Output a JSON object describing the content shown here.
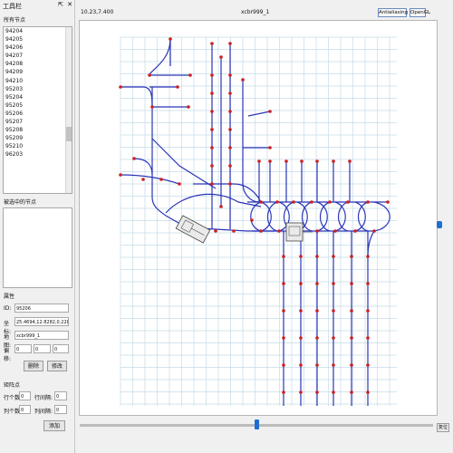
{
  "panel": {
    "title": "工具栏",
    "pin_glyph": "⇱",
    "close_glyph": "✕",
    "all_nodes_label": "所有节点",
    "nodes": [
      "94204",
      "94205",
      "94206",
      "94207",
      "94208",
      "94209",
      "94210",
      "95203",
      "95204",
      "95205",
      "95206",
      "95207",
      "95208",
      "95209",
      "95210",
      "96203"
    ],
    "selected_nodes_label": "被选中的节点",
    "attr_label": "属性",
    "id_label": "ID:",
    "id_value": "95206",
    "coord_label": "坐标:",
    "coord_value": "25.4694,12.8282,0.228",
    "map_label": "地图:",
    "map_value": "xcbr999_1",
    "param_label": "偏移:",
    "param_values": [
      "0",
      "0",
      "0"
    ],
    "btn_delete": "删除",
    "btn_modify": "修改",
    "grid_label": "矩阵点",
    "row_count_label": "行个数:",
    "row_count_value": "0",
    "row_gap_label": "行间隔:",
    "row_gap_value": "0",
    "col_count_label": "列个数:",
    "col_count_value": "0",
    "col_gap_label": "列间隔:",
    "col_gap_value": "0",
    "btn_add": "添加"
  },
  "topbar": {
    "cursor_coords": "10.23,7.400",
    "map_title": "xcbr999_1",
    "btn_antialiasing": "Antialiasing",
    "btn_opengl": "OpenGL"
  },
  "bottom": {
    "reset_label": "复位",
    "zoom_position": 0.5
  },
  "colors": {
    "path_blue": "#2a35b8",
    "node_red": "#cc1f1f",
    "grid": "#c5dbe8",
    "accent": "#1f6fd1"
  }
}
